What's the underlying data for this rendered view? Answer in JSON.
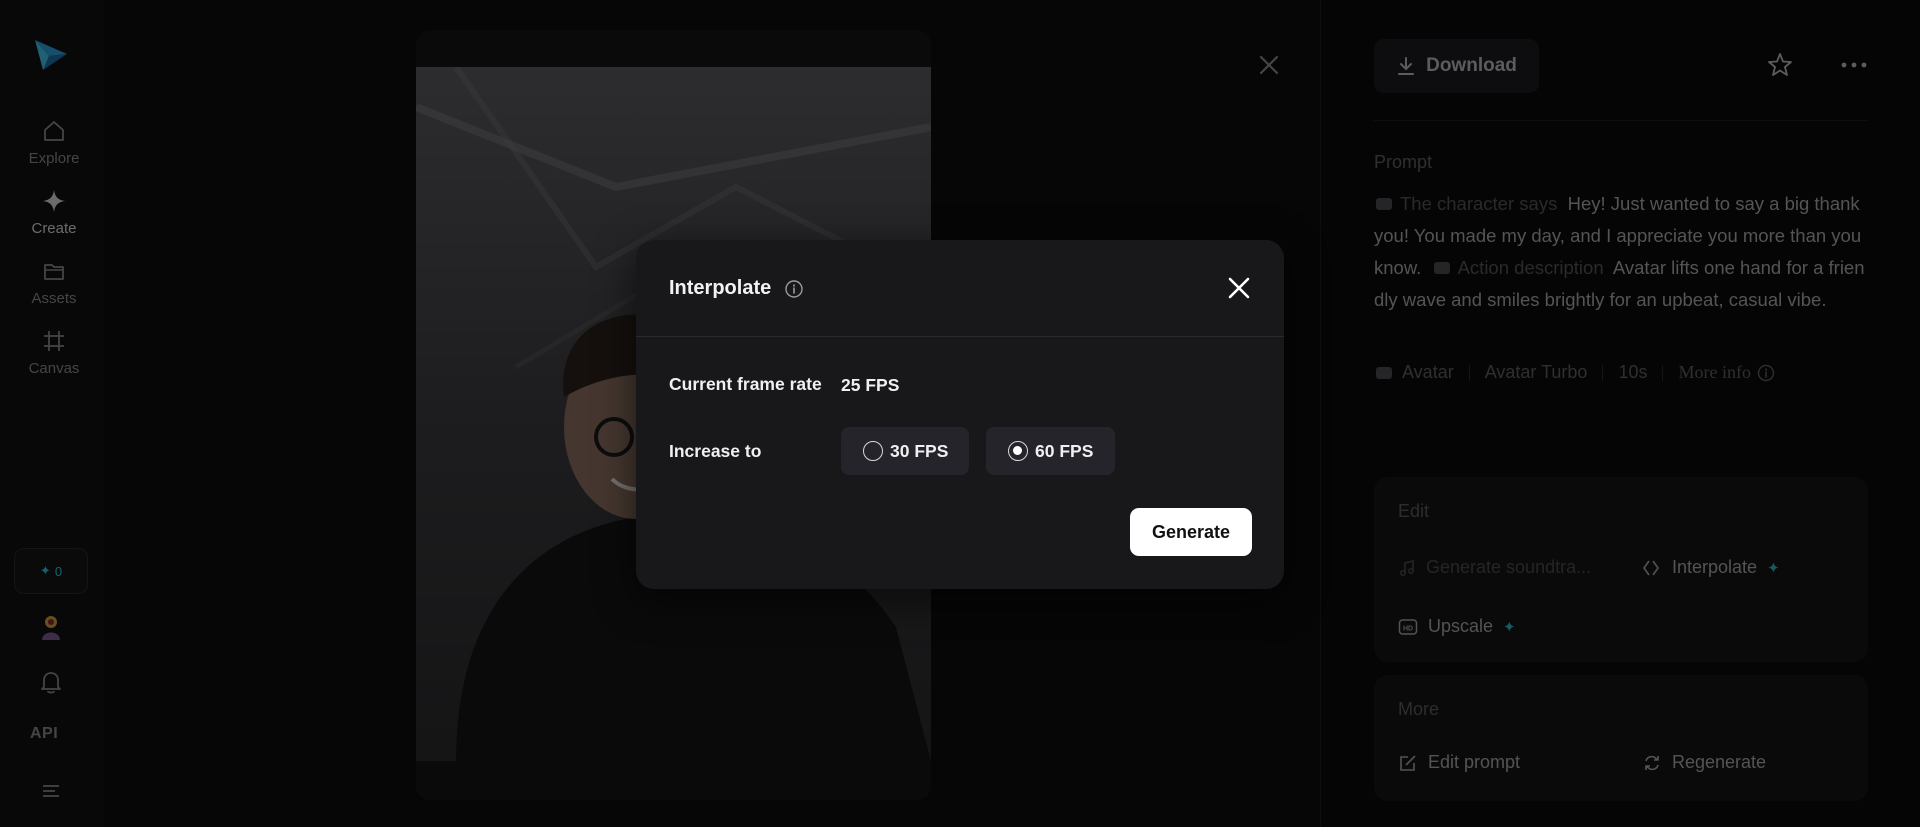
{
  "sidebar": {
    "items": [
      {
        "label": "Explore",
        "icon": "home-icon"
      },
      {
        "label": "Create",
        "icon": "sparkle-icon"
      },
      {
        "label": "Assets",
        "icon": "folder-icon"
      },
      {
        "label": "Canvas",
        "icon": "frame-icon"
      }
    ],
    "credits": "0",
    "api_label": "API"
  },
  "right_panel": {
    "download_label": "Download",
    "prompt_title": "Prompt",
    "prompt": {
      "tag1": "The character says",
      "text1": "Hey! Just wanted to say a big thank you! You made my day, and I appreciate you more than you know.",
      "tag2": "Action description",
      "text2": "Avatar lifts one hand for a friendly wave and smiles brightly for an upbeat, casual vibe."
    },
    "meta": {
      "model": "Avatar",
      "variant": "Avatar Turbo",
      "duration": "10s",
      "more_info": "More info"
    },
    "edit_panel": {
      "title": "Edit",
      "soundtrack": "Generate soundtra...",
      "interpolate": "Interpolate",
      "upscale": "Upscale"
    },
    "more_panel": {
      "title": "More",
      "edit_prompt": "Edit prompt",
      "regenerate": "Regenerate"
    }
  },
  "modal": {
    "title": "Interpolate",
    "current_label": "Current frame rate",
    "current_value": "25 FPS",
    "increase_label": "Increase to",
    "options": [
      {
        "label": "30 FPS",
        "selected": false
      },
      {
        "label": "60 FPS",
        "selected": true
      }
    ],
    "generate_label": "Generate"
  },
  "colors": {
    "accent": "#2ec6d6",
    "modal_bg": "#18181b",
    "button_bg": "#ffffff"
  }
}
